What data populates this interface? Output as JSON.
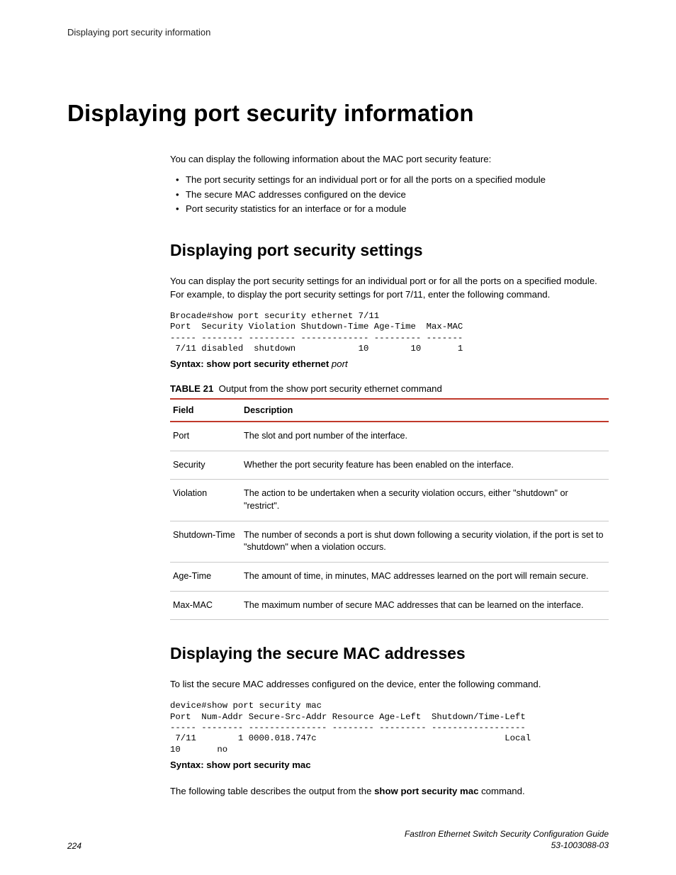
{
  "running_header": "Displaying port security information",
  "main_heading": "Displaying port security information",
  "intro": "You can display the following information about the MAC port security feature:",
  "bullets": [
    "The port security settings for an individual port or for all the ports on a specified module",
    "The secure MAC addresses configured on the device",
    "Port security statistics for an interface or for a module"
  ],
  "section1": {
    "heading": "Displaying port security settings",
    "para": "You can display the port security settings for an individual port or for all the ports on a specified module. For example, to display the port security settings for port 7/11, enter the following command.",
    "code": "Brocade#show port security ethernet 7/11\nPort  Security Violation Shutdown-Time Age-Time  Max-MAC\n----- -------- --------- ------------- --------- -------\n 7/11 disabled  shutdown            10        10       1",
    "syntax_bold": "Syntax: show port security ethernet ",
    "syntax_italic": "port",
    "table_caption_label": "TABLE 21",
    "table_caption_text": "Output from the show port security ethernet command",
    "table": {
      "head_field": "Field",
      "head_desc": "Description",
      "rows": [
        {
          "f": "Port",
          "d": "The slot and port number of the interface."
        },
        {
          "f": "Security",
          "d": "Whether the port security feature has been enabled on the interface."
        },
        {
          "f": "Violation",
          "d": "The action to be undertaken when a security violation occurs, either \"shutdown\" or \"restrict\"."
        },
        {
          "f": "Shutdown-Time",
          "d": "The number of seconds a port is shut down following a security violation, if the port is set to \"shutdown\" when a violation occurs."
        },
        {
          "f": "Age-Time",
          "d": "The amount of time, in minutes, MAC addresses learned on the port will remain secure."
        },
        {
          "f": "Max-MAC",
          "d": "The maximum number of secure MAC addresses that can be learned on the interface."
        }
      ]
    }
  },
  "section2": {
    "heading": "Displaying the secure MAC addresses",
    "para": "To list the secure MAC addresses configured on the device, enter the following command.",
    "code": "device#show port security mac\nPort  Num-Addr Secure-Src-Addr Resource Age-Left  Shutdown/Time-Left\n----- -------- --------------- -------- --------- ------------------\n 7/11        1 0000.018.747c                                    Local         \n10       no",
    "syntax_bold": "Syntax: show port security mac",
    "after_pre": "The following table describes the output from the ",
    "after_bold": "show port security mac",
    "after_tail": " command."
  },
  "footer": {
    "page": "224",
    "guide_line1": "FastIron Ethernet Switch Security Configuration Guide",
    "guide_line2": "53-1003088-03"
  }
}
